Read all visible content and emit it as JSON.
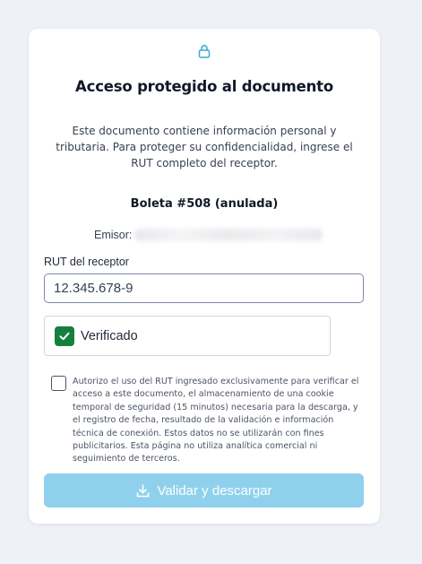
{
  "card": {
    "title": "Acceso protegido al documento",
    "description": "Este documento contiene información personal y tributaria. Para proteger su confidencialidad, ingrese el RUT completo del receptor.",
    "document_title": "Boleta #508 (anulada)",
    "emisor_label": "Emisor:"
  },
  "form": {
    "rut_label": "RUT del receptor",
    "rut_value": "12.345.678-9",
    "verified_label": "Verificado",
    "consent_text": "Autorizo el uso del RUT ingresado exclusivamente para verificar el acceso a este documento, el almacenamiento de una cookie temporal de seguridad (15 minutos) necesaria para la descarga, y el registro de fecha, resultado de la validación e información técnica de conexión. Estos datos no se utilizarán con fines publicitarios. Esta página no utiliza analítica comercial ni seguimiento de terceros.",
    "submit_label": "Validar y descargar"
  },
  "icons": {
    "header": "lock-icon",
    "verified": "check-icon",
    "submit": "download-icon"
  },
  "colors": {
    "accent": "#3aa8d8",
    "verified": "#15803d",
    "submit_disabled": "#8fd1ec",
    "page_background": "#eef1f6"
  }
}
